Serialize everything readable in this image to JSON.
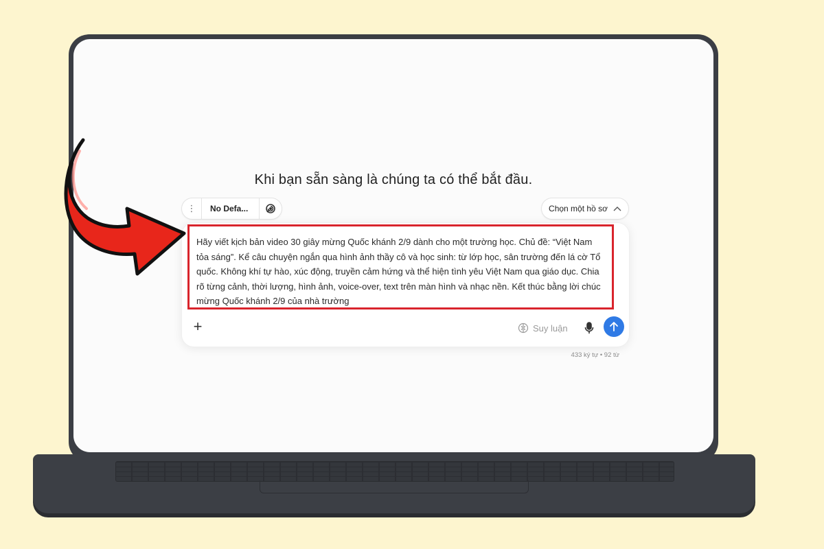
{
  "screen": {
    "headline": "Khi bạn sẵn sàng là chúng ta có thể bắt đầu."
  },
  "toolbar": {
    "menu_icon": "vertical-dots-icon",
    "model_label": "No Defa...",
    "mode_icon": "spiral-icon",
    "profile_label": "Chọn một hồ sơ",
    "profile_icon": "chevron-up-icon"
  },
  "composer": {
    "prompt_text": "Hãy viết kịch bản video 30 giây mừng Quốc khánh 2/9 dành cho một trường học. Chủ đề: “Việt Nam tỏa sáng”. Kể câu chuyện ngắn qua hình ảnh thầy cô và học sinh: từ lớp học, sân trường đến lá cờ Tổ quốc. Không khí tự hào, xúc động, truyền cảm hứng và thể hiện tình yêu Việt Nam qua giáo dục. Chia rõ từng cảnh, thời lượng, hình ảnh, voice-over, text trên màn hình và nhạc nền. Kết thúc bằng lời chúc mừng Quốc khánh 2/9 của nhà trường",
    "plus_label": "+",
    "reasoning_label": "Suy luận",
    "reasoning_icon": "brain-icon",
    "mic_icon": "microphone-icon",
    "send_icon": "arrow-up-icon",
    "counter": "433 ký tự • 92 từ"
  },
  "colors": {
    "background": "#fdf5cf",
    "highlight_border": "#d9242c",
    "arrow": "#e8261b",
    "send_button": "#2f7ae5",
    "laptop_body": "#3b3e44"
  }
}
